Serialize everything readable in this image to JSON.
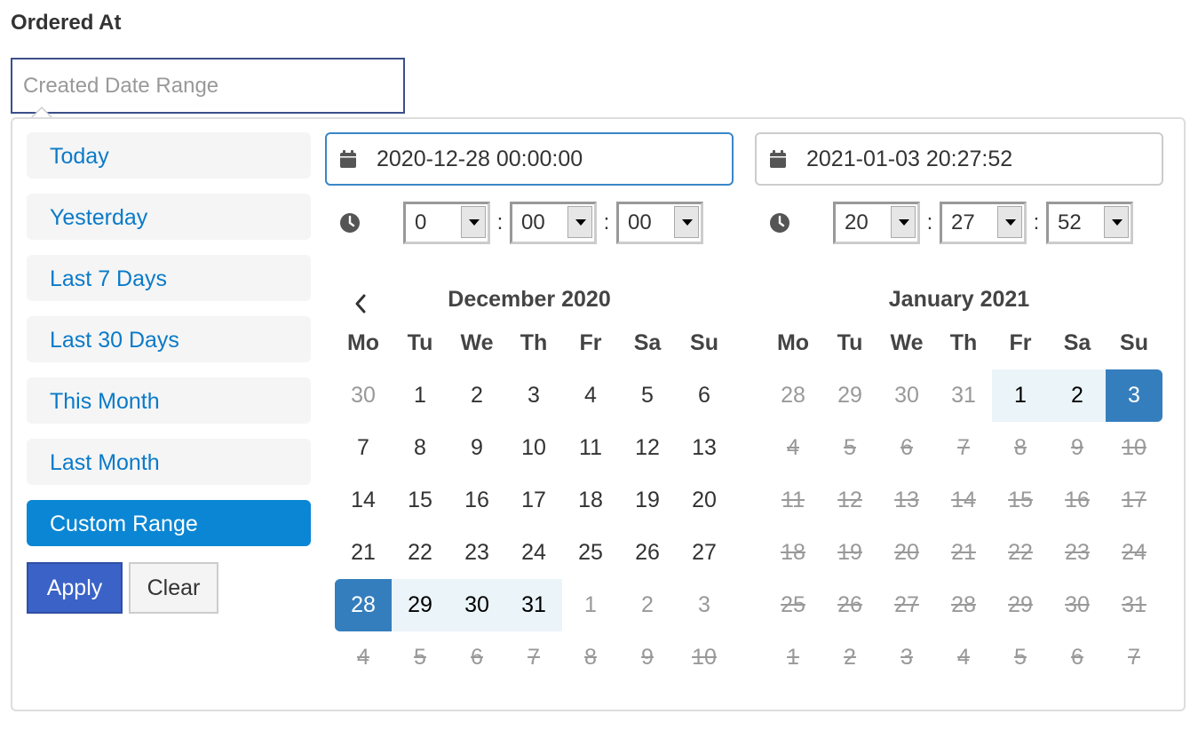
{
  "label": "Ordered At",
  "input": {
    "value": "",
    "placeholder": "Created Date Range"
  },
  "ranges": [
    {
      "label": "Today",
      "active": false
    },
    {
      "label": "Yesterday",
      "active": false
    },
    {
      "label": "Last 7 Days",
      "active": false
    },
    {
      "label": "Last 30 Days",
      "active": false
    },
    {
      "label": "This Month",
      "active": false
    },
    {
      "label": "Last Month",
      "active": false
    },
    {
      "label": "Custom Range",
      "active": true
    }
  ],
  "buttons": {
    "apply": "Apply",
    "clear": "Clear"
  },
  "weekdays": [
    "Mo",
    "Tu",
    "We",
    "Th",
    "Fr",
    "Sa",
    "Su"
  ],
  "left": {
    "date": "2020-12-28 00:00:00",
    "time": {
      "hour": "0",
      "minute": "00",
      "second": "00"
    },
    "month": "December 2020",
    "weeks": [
      [
        {
          "d": "30",
          "s": "off"
        },
        {
          "d": "1"
        },
        {
          "d": "2"
        },
        {
          "d": "3"
        },
        {
          "d": "4"
        },
        {
          "d": "5"
        },
        {
          "d": "6"
        }
      ],
      [
        {
          "d": "7"
        },
        {
          "d": "8"
        },
        {
          "d": "9"
        },
        {
          "d": "10"
        },
        {
          "d": "11"
        },
        {
          "d": "12"
        },
        {
          "d": "13"
        }
      ],
      [
        {
          "d": "14"
        },
        {
          "d": "15"
        },
        {
          "d": "16"
        },
        {
          "d": "17"
        },
        {
          "d": "18"
        },
        {
          "d": "19"
        },
        {
          "d": "20"
        }
      ],
      [
        {
          "d": "21"
        },
        {
          "d": "22"
        },
        {
          "d": "23"
        },
        {
          "d": "24"
        },
        {
          "d": "25"
        },
        {
          "d": "26"
        },
        {
          "d": "27"
        }
      ],
      [
        {
          "d": "28",
          "s": "start"
        },
        {
          "d": "29",
          "s": "in"
        },
        {
          "d": "30",
          "s": "in"
        },
        {
          "d": "31",
          "s": "in"
        },
        {
          "d": "1",
          "s": "off"
        },
        {
          "d": "2",
          "s": "off"
        },
        {
          "d": "3",
          "s": "off"
        }
      ],
      [
        {
          "d": "4",
          "s": "dis"
        },
        {
          "d": "5",
          "s": "dis"
        },
        {
          "d": "6",
          "s": "dis"
        },
        {
          "d": "7",
          "s": "dis"
        },
        {
          "d": "8",
          "s": "dis"
        },
        {
          "d": "9",
          "s": "dis"
        },
        {
          "d": "10",
          "s": "dis"
        }
      ]
    ]
  },
  "right": {
    "date": "2021-01-03 20:27:52",
    "time": {
      "hour": "20",
      "minute": "27",
      "second": "52"
    },
    "month": "January 2021",
    "weeks": [
      [
        {
          "d": "28",
          "s": "off"
        },
        {
          "d": "29",
          "s": "off"
        },
        {
          "d": "30",
          "s": "off"
        },
        {
          "d": "31",
          "s": "off"
        },
        {
          "d": "1",
          "s": "in"
        },
        {
          "d": "2",
          "s": "in"
        },
        {
          "d": "3",
          "s": "end"
        }
      ],
      [
        {
          "d": "4",
          "s": "dis"
        },
        {
          "d": "5",
          "s": "dis"
        },
        {
          "d": "6",
          "s": "dis"
        },
        {
          "d": "7",
          "s": "dis"
        },
        {
          "d": "8",
          "s": "dis"
        },
        {
          "d": "9",
          "s": "dis"
        },
        {
          "d": "10",
          "s": "dis"
        }
      ],
      [
        {
          "d": "11",
          "s": "dis"
        },
        {
          "d": "12",
          "s": "dis"
        },
        {
          "d": "13",
          "s": "dis"
        },
        {
          "d": "14",
          "s": "dis"
        },
        {
          "d": "15",
          "s": "dis"
        },
        {
          "d": "16",
          "s": "dis"
        },
        {
          "d": "17",
          "s": "dis"
        }
      ],
      [
        {
          "d": "18",
          "s": "dis"
        },
        {
          "d": "19",
          "s": "dis"
        },
        {
          "d": "20",
          "s": "dis"
        },
        {
          "d": "21",
          "s": "dis"
        },
        {
          "d": "22",
          "s": "dis"
        },
        {
          "d": "23",
          "s": "dis"
        },
        {
          "d": "24",
          "s": "dis"
        }
      ],
      [
        {
          "d": "25",
          "s": "dis"
        },
        {
          "d": "26",
          "s": "dis"
        },
        {
          "d": "27",
          "s": "dis"
        },
        {
          "d": "28",
          "s": "dis"
        },
        {
          "d": "29",
          "s": "dis"
        },
        {
          "d": "30",
          "s": "dis"
        },
        {
          "d": "31",
          "s": "dis"
        }
      ],
      [
        {
          "d": "1",
          "s": "dis"
        },
        {
          "d": "2",
          "s": "dis"
        },
        {
          "d": "3",
          "s": "dis"
        },
        {
          "d": "4",
          "s": "dis"
        },
        {
          "d": "5",
          "s": "dis"
        },
        {
          "d": "6",
          "s": "dis"
        },
        {
          "d": "7",
          "s": "dis"
        }
      ]
    ]
  },
  "icons": {
    "calendar": "calendar-icon",
    "clock": "clock-icon",
    "prev": "chevron-left-icon"
  },
  "colors": {
    "link": "#0a7ac9",
    "active_range": "#0a86d4",
    "apply": "#3b62c7",
    "selected": "#357ebd",
    "in_range": "#ebf4f8"
  }
}
